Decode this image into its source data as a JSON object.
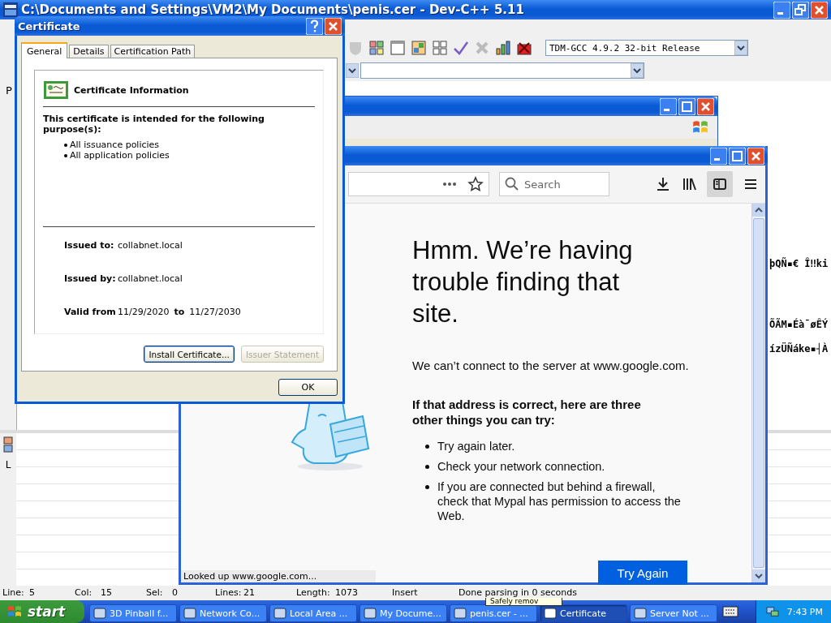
{
  "devcpp": {
    "title": "C:\\Documents and Settings\\VM2\\My Documents\\penis.cer - Dev-C++ 5.11",
    "compiler": "TDM-GCC 4.9.2 32-bit Release",
    "side_tab": "P",
    "bottom_tab": "L",
    "editor_lines": [
      "þQÑ▪€ Î‼ki",
      "ÕÃM▪Éà¯øÊÝ",
      "ízÜÑáke▪┤À"
    ],
    "status_bar": [
      "Line:",
      "5",
      "Col:",
      "15",
      "Sel:",
      "0",
      "Lines:",
      "21",
      "Length:",
      "1073",
      "Insert",
      "Done parsing in 0 seconds"
    ]
  },
  "browser": {
    "search": {
      "placeholder": "Search"
    },
    "sidebar_on": true,
    "heading": "Hmm. We’re having trouble finding that site.",
    "message": "We can’t connect to the server at www.google.com.",
    "subheading": "If that address is correct, here are three other things you can try:",
    "tips": [
      "Try again later.",
      "Check your network connection.",
      "If you are connected but behind a firewall, check that Mypal has permission to access the Web."
    ],
    "button": "Try Again",
    "status": "Looked up www.google.com..."
  },
  "certificate": {
    "title": "Certificate",
    "tabs": [
      {
        "label": "General",
        "selected": true
      },
      {
        "label": "Details",
        "selected": false
      },
      {
        "label": "Certification Path",
        "selected": false
      }
    ],
    "heading": "Certificate Information",
    "purpose_title": "This certificate is intended for the following purpose(s):",
    "purposes": [
      "All issuance policies",
      "All application policies"
    ],
    "fields": [
      {
        "label": "Issued to:",
        "value": "collabnet.local"
      },
      {
        "label": "Issued by:",
        "value": "collabnet.local"
      }
    ],
    "valid": {
      "label": "Valid from",
      "from": "11/29/2020",
      "to_label": "to",
      "to": "11/27/2030"
    },
    "buttons": [
      {
        "label": "Install Certificate...",
        "disabled": false
      },
      {
        "label": "Issuer Statement",
        "disabled": true
      }
    ],
    "ok": "OK"
  },
  "taskbar": {
    "start": "start",
    "items": [
      {
        "label": "3D Pinball f...",
        "selected": false
      },
      {
        "label": "Network Co...",
        "selected": false
      },
      {
        "label": "Local Area ...",
        "selected": false
      },
      {
        "label": "My Docume...",
        "selected": false
      },
      {
        "label": "penis.cer - ...",
        "selected": false
      },
      {
        "label": "Certificate",
        "selected": true
      },
      {
        "label": "Server Not ...",
        "selected": false
      }
    ],
    "balloon": "Safely remov",
    "clock": "7:43 PM"
  }
}
